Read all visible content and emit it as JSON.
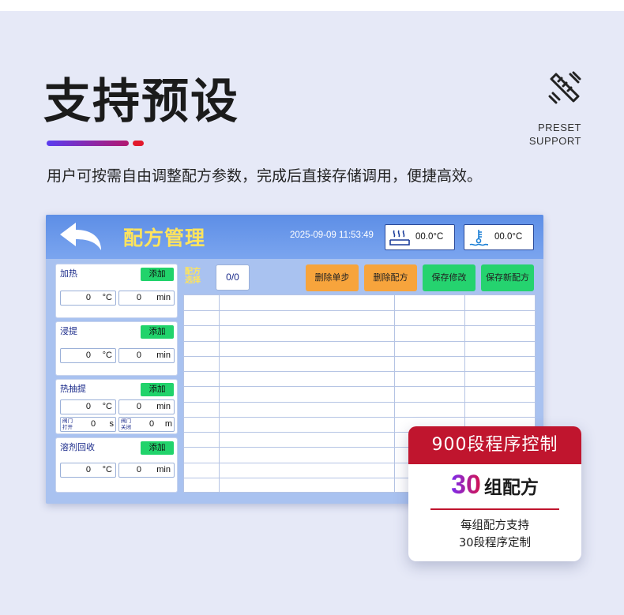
{
  "heading": {
    "title": "支持预设",
    "badge_line1": "PRESET",
    "badge_line2": "SUPPORT",
    "description": "用户可按需自由调整配方参数，完成后直接存储调用，便捷高效。"
  },
  "screen": {
    "title": "配方管理",
    "datetime": "2025-09-09 11:53:49",
    "temp1": "00.0°C",
    "temp2": "00.0°C",
    "icons": {
      "back": "back-arrow-icon",
      "temp1": "heater-icon",
      "temp2": "liquid-temperature-icon"
    },
    "sections": [
      {
        "title": "加热",
        "add": "添加",
        "temp": "0",
        "temp_unit": "°C",
        "time": "0",
        "time_unit": "min"
      },
      {
        "title": "浸提",
        "add": "添加",
        "temp": "0",
        "temp_unit": "°C",
        "time": "0",
        "time_unit": "min"
      },
      {
        "title": "热抽提",
        "add": "添加",
        "temp": "0",
        "temp_unit": "°C",
        "time": "0",
        "time_unit": "min",
        "valve_open_l1": "阀门",
        "valve_open_l2": "打开",
        "valve_open_value": "0",
        "valve_open_unit": "s",
        "valve_close_l1": "阀门",
        "valve_close_l2": "关闭",
        "valve_close_value": "0",
        "valve_close_unit": "m"
      },
      {
        "title": "溶剂回收",
        "add": "添加",
        "temp": "0",
        "temp_unit": "°C",
        "time": "0",
        "time_unit": "min"
      }
    ],
    "recipe_select_l1": "配方",
    "recipe_select_l2": "选择",
    "recipe_value": "0/0",
    "buttons": {
      "delete_step": "删除单步",
      "delete_recipe": "删除配方",
      "save_changes": "保存修改",
      "save_new": "保存新配方"
    },
    "colors": {
      "orange": "#f7a43c",
      "green": "#25d36f",
      "title": "#ffe45c"
    }
  },
  "promo": {
    "head": "900段程序控制",
    "number": "30",
    "unit": "组配方",
    "foot_line1": "每组配方支持",
    "foot_line2": "30段程序定制"
  }
}
